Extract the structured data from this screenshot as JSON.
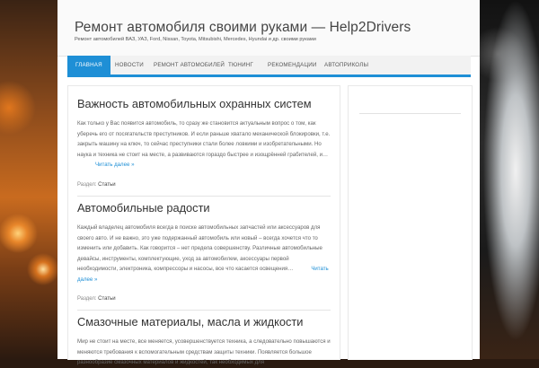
{
  "site": {
    "title": "Ремонт автомобиля своими руками — Help2Drivers",
    "description": "Ремонт автомобилей ВАЗ, УАЗ, Ford, Nissan, Toyota, Mitsubishi, Mercedes, Hyundai и др. своими руками"
  },
  "nav": {
    "items": [
      {
        "label": "Главная",
        "active": true
      },
      {
        "label": "Новости"
      },
      {
        "label": "Ремонт автомобилей"
      },
      {
        "label": "Тюнинг"
      },
      {
        "label": "Рекомендации"
      },
      {
        "label": "Автоприколы"
      }
    ]
  },
  "posts": [
    {
      "title": "Важность автомобильных охранных систем",
      "excerpt": "Как только у Вас появится автомобиль, то сразу же становится актуальным вопрос о том, как уберечь его от посягательств преступников. И если раньше хватало механической блокировки, т.е. закрыть машину на ключ, то сейчас преступники стали более ловкими и изобретательными. Но наука и техника не стоит на месте, а развиваются гораздо быстрее и изощрённей грабителей, и…",
      "read_more": "Читать далее »",
      "meta_label": "Раздел:",
      "category": "Статьи"
    },
    {
      "title": "Автомобильные радости",
      "excerpt": "Каждый владелец автомобиля всегда в поиске автомобильных запчастей или аксессуаров для своего авто. И не важно, это уже подержанный автомобиль или новый – всегда хочется что то изменить или добавить. Как говорится – нет предела совершенству. Различные автомобильные девайсы, инструменты, комплектующие, уход за автомобилем, аксессуары первой необходимости, электроника, компрессоры и насосы, все что касается освещения…",
      "read_more": "Читать далее »",
      "meta_label": "Раздел:",
      "category": "Статьи"
    },
    {
      "title": "Смазочные материалы, масла и жидкости",
      "excerpt": "Мир не стоит на месте, все меняется, усовершенствуется техника, а следовательно повышаются и меняются требования к вспомогательным средствам защиты техники. Появляется большое разнообразие смазочных материалов и жидкостей, так необходимых для"
    }
  ]
}
